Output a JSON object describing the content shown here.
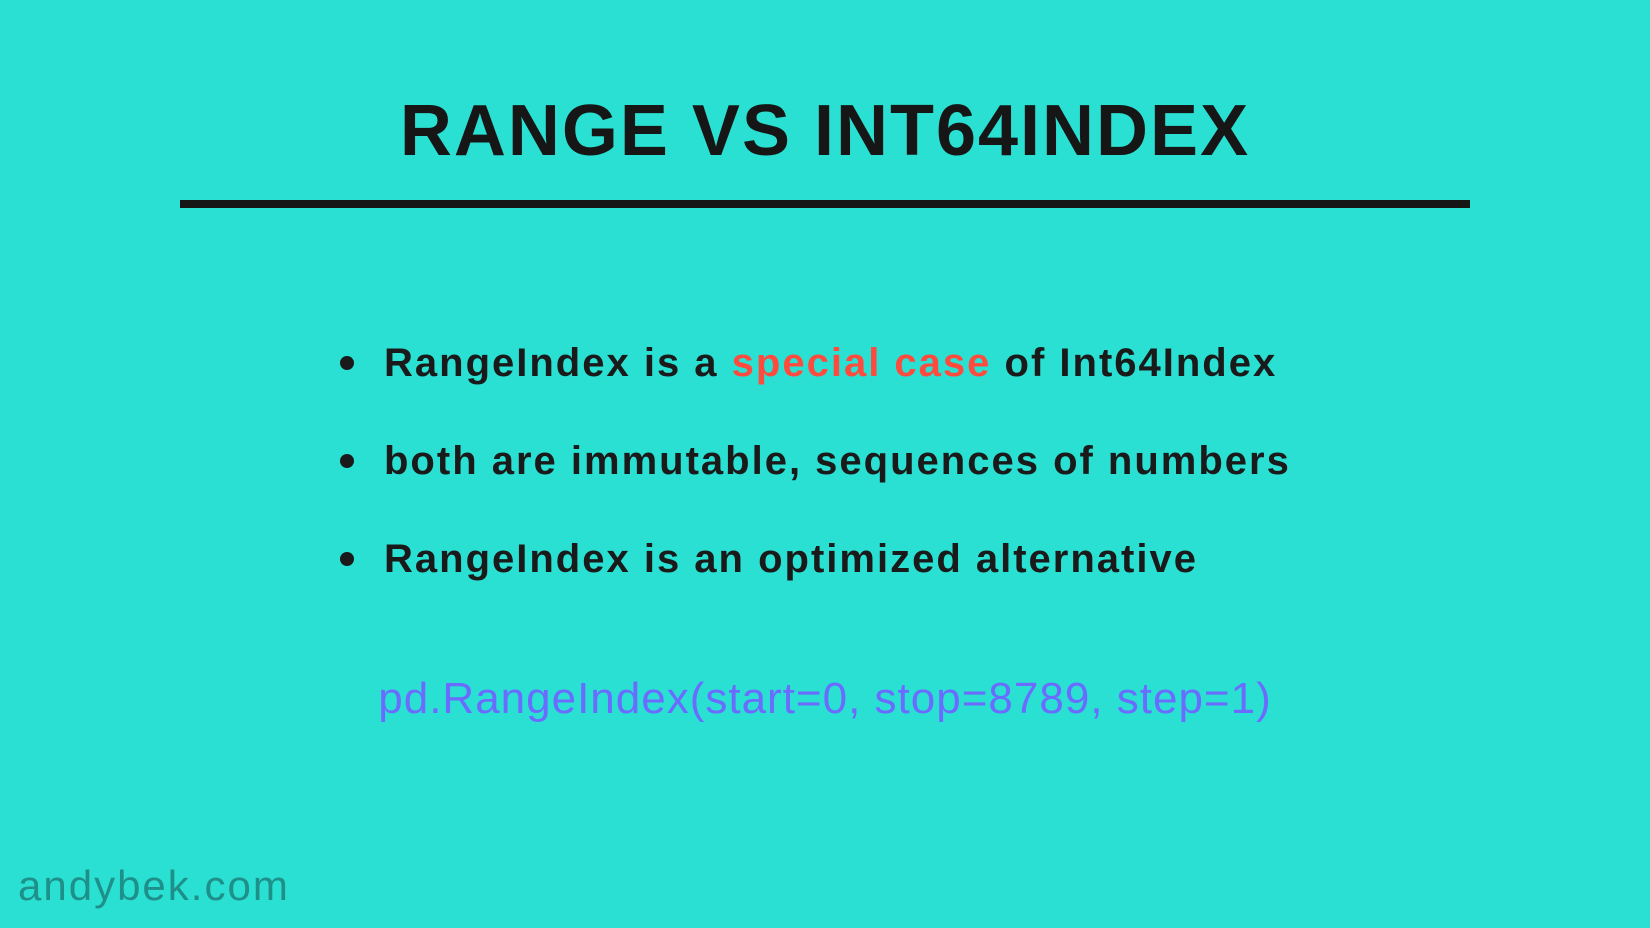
{
  "title": "RANGE VS INT64INDEX",
  "bullets": [
    {
      "pre": "RangeIndex is a ",
      "hi": "special case",
      "post": " of Int64Index"
    },
    {
      "pre": "both are immutable, sequences of numbers",
      "hi": "",
      "post": ""
    },
    {
      "pre": "RangeIndex is an optimized alternative",
      "hi": "",
      "post": ""
    }
  ],
  "code": "pd.RangeIndex(start=0, stop=8789, step=1)",
  "footer": "andybek.com"
}
